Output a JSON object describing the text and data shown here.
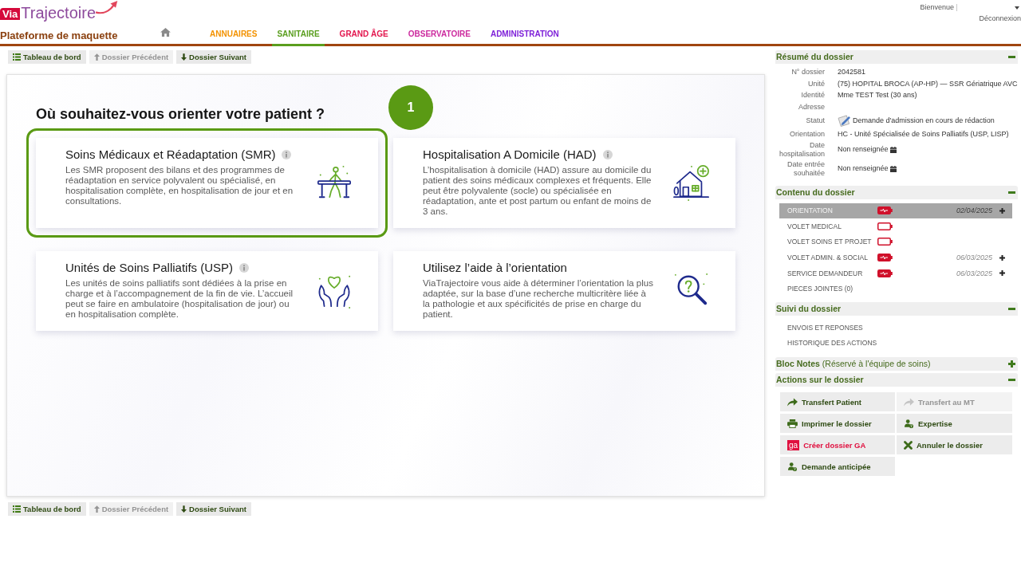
{
  "header": {
    "logo": {
      "mark": "Via",
      "name": "Trajectoire"
    },
    "platform": "Plateforme de maquette",
    "nav": [
      {
        "label": "ANNUAIRES",
        "color": "#f39200",
        "selected": false
      },
      {
        "label": "SANITAIRE",
        "color": "#5a9e1e",
        "selected": true
      },
      {
        "label": "GRAND ÂGE",
        "color": "#e3154d",
        "selected": false
      },
      {
        "label": "OBSERVATOIRE",
        "color": "#cc2a9e",
        "selected": false
      },
      {
        "label": "ADMINISTRATION",
        "color": "#7d1fd8",
        "selected": false
      }
    ],
    "user": {
      "greeting": "Bienvenue",
      "logout": "Déconnexion"
    }
  },
  "toolbar_top": [
    {
      "label": "Tableau de bord",
      "kind": "dashboard",
      "disabled": false
    },
    {
      "label": "Dossier Précédent",
      "kind": "previous",
      "disabled": true
    },
    {
      "label": "Dossier Suivant",
      "kind": "next",
      "disabled": false
    }
  ],
  "main": {
    "title": "Où souhaitez-vous orienter votre patient ?",
    "step": "1",
    "cards": [
      {
        "title": "Soins Médicaux et Réadaptation (SMR)",
        "info": true,
        "description": "Les SMR proposent des bilans et des programmes de réadaptation en service polyvalent ou spécialisé, en hospitalisation complète, en hospitalisation de jour et en consultations.",
        "kind": "rehab",
        "selected": true
      },
      {
        "title": "Hospitalisation A Domicile (HAD)",
        "info": true,
        "description": "L’hospitalisation à domicile (HAD) assure au domicile du patient des soins médicaux complexes et fréquents. Elle peut être polyvalente (socle) ou spécialisée en réadaptation, ante et post partum ou enfant de moins de 3 ans.",
        "kind": "home",
        "selected": false
      },
      {
        "title": "Unités de Soins Palliatifs (USP)",
        "info": true,
        "description": "Les unités de soins palliatifs sont dédiées à la prise en charge et à l’accompagnement de la fin de vie. L’accueil peut se faire en ambulatoire (hospitalisation de jour) ou en hospitalisation complète.",
        "kind": "palliative",
        "selected": false
      },
      {
        "title": "Utilisez l’aide à l’orientation",
        "info": false,
        "description": "ViaTrajectoire vous aide à déterminer l’orientation la plus adaptée, sur la base d’une recherche multicritère liée à la pathologie et aux spécificités de prise en charge du patient.",
        "kind": "search",
        "selected": false
      }
    ]
  },
  "toolbar_bottom": [
    {
      "label": "Tableau de bord",
      "kind": "dashboard",
      "disabled": false
    },
    {
      "label": "Dossier Précédent",
      "kind": "previous",
      "disabled": true
    },
    {
      "label": "Dossier Suivant",
      "kind": "next",
      "disabled": false
    }
  ],
  "summary": {
    "title": "Résumé du dossier",
    "expanded": true,
    "fields": [
      {
        "label": "N° dossier",
        "value": "2042581",
        "kind": "text"
      },
      {
        "label": "Unité",
        "value": "(75) HOPITAL BROCA (AP-HP) — SSR Gériatrique AVC",
        "kind": "text"
      },
      {
        "label": "Identité",
        "value": "Mme TEST Test (30 ans)",
        "kind": "text"
      },
      {
        "label": "Adresse",
        "kind": "text"
      },
      {
        "label": "Statut",
        "value": "Demande d'admission en cours de rédaction",
        "kind": "status"
      },
      {
        "label": "Orientation",
        "value": "HC - Unité Spécialisée de Soins Palliatifs (USP, LISP)",
        "kind": "text"
      },
      {
        "label": "Date hospitalisation",
        "value": "Non renseignée",
        "kind": "date"
      },
      {
        "label": "Date entrée souhaitée",
        "value": "Non renseignée",
        "kind": "date"
      }
    ]
  },
  "contents": {
    "title": "Contenu du dossier",
    "expanded": true,
    "items": [
      {
        "label": "ORIENTATION",
        "kind": "section",
        "selected": true,
        "complete": true,
        "date": "02/04/2025",
        "addable": true
      },
      {
        "label": "VOLET MEDICAL",
        "kind": "section",
        "selected": false,
        "complete": false,
        "addable": false
      },
      {
        "label": "VOLET SOINS ET PROJET",
        "kind": "section",
        "selected": false,
        "complete": false,
        "addable": false
      },
      {
        "label": "VOLET ADMIN. & SOCIAL",
        "kind": "section",
        "selected": false,
        "complete": true,
        "date": "06/03/2025",
        "addable": true
      },
      {
        "label": "SERVICE DEMANDEUR",
        "kind": "section",
        "selected": false,
        "complete": true,
        "date": "06/03/2025",
        "addable": true
      },
      {
        "label": "PIECES JOINTES (0)",
        "kind": "attachments",
        "selected": false,
        "addable": false
      }
    ]
  },
  "follow_up": {
    "title": "Suivi du dossier",
    "expanded": true,
    "items": [
      {
        "label": "ENVOIS ET REPONSES",
        "selected": false
      },
      {
        "label": "HISTORIQUE DES ACTIONS",
        "selected": false
      }
    ]
  },
  "notes": {
    "title": "Bloc Notes",
    "note": "(Réservé à l'équipe de soins)",
    "expanded": false
  },
  "actions": {
    "title": "Actions sur le dossier",
    "expanded": true,
    "buttons": [
      {
        "label": "Transfert Patient",
        "kind": "forward",
        "disabled": false
      },
      {
        "label": "Transfert au MT",
        "kind": "forward",
        "disabled": true
      },
      {
        "label": "Imprimer le dossier",
        "kind": "print",
        "disabled": false
      },
      {
        "label": "Expertise",
        "kind": "expert",
        "disabled": false
      },
      {
        "label": "Créer dossier GA",
        "kind": "ga",
        "badge": "ga",
        "disabled": false
      },
      {
        "label": "Annuler le dossier",
        "kind": "cancel",
        "disabled": false
      },
      {
        "label": "Demande anticipée",
        "kind": "expert",
        "disabled": false
      }
    ]
  }
}
